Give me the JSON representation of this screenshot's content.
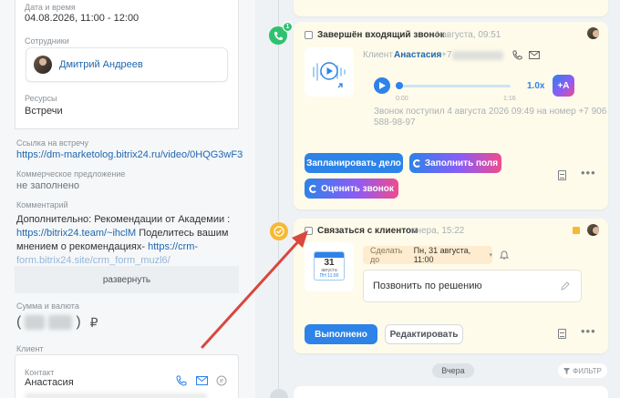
{
  "left": {
    "date": {
      "label": "Дата и время",
      "value": "04.08.2026, 11:00 - 12:00"
    },
    "employees": {
      "label": "Сотрудники",
      "name": "Дмитрий Андреев"
    },
    "resources": {
      "label": "Ресурсы",
      "value": "Встречи"
    },
    "meeting_link": {
      "label": "Ссылка на встречу",
      "value": "https://dm-marketolog.bitrix24.ru/video/0HQG3wF3"
    },
    "offer": {
      "label": "Коммерческое предложение",
      "value": "не заполнено"
    },
    "comment": {
      "label": "Комментарий",
      "line1": "Дополнительно: Рекомендации от Академии :",
      "line2_link": "https://bitrix24.team/~ihclM",
      "line2_rest": " Поделитесь вашим",
      "line3": "мнением о рекомендациях- ",
      "line3_link": "https://crm-",
      "line4": "form.bitrix24.site/crm_form_muzl6/"
    },
    "expand_label": "развернуть",
    "sum": {
      "label": "Сумма и валюта",
      "currency": "₽"
    },
    "client": {
      "label": "Клиент",
      "contact_label": "Контакт",
      "contact_name": "Анастасия"
    }
  },
  "timeline": {
    "call_card": {
      "title": "Завершён входящий звонок",
      "time": "4 августа, 09:51",
      "badge": "1",
      "client_label": "Клиент",
      "client_name": "Анастасия",
      "client_phone_prefix": "+7",
      "time_start": "0:00",
      "time_end": "1:16",
      "speed": "1.0x",
      "transcribe": "+A",
      "info_line1": "Звонок поступил 4 августа 2026 09:49 на номер +7 906",
      "info_line2": "588-98-97",
      "btn_plan": "Запланировать дело",
      "btn_fill": "Заполнить поля",
      "btn_rate": "Оценить звонок"
    },
    "task_card": {
      "title": "Связаться с клиентом",
      "time": "вчера, 15:22",
      "cal_day": "31",
      "cal_month": "августа",
      "cal_time": "ПН 11:00",
      "deadline_prefix": "Сделать до",
      "deadline_value": "Пн, 31 августа, 11:00",
      "description": "Позвонить по решению",
      "btn_done": "Выполнено",
      "btn_edit": "Редактировать"
    },
    "divider_label": "Вчера",
    "filter_label": "ФИЛЬТР"
  },
  "colors": {
    "accent": "#2d83e8",
    "green": "#2fc26e",
    "yellow": "#f5b935",
    "arrow": "#d9473f"
  }
}
